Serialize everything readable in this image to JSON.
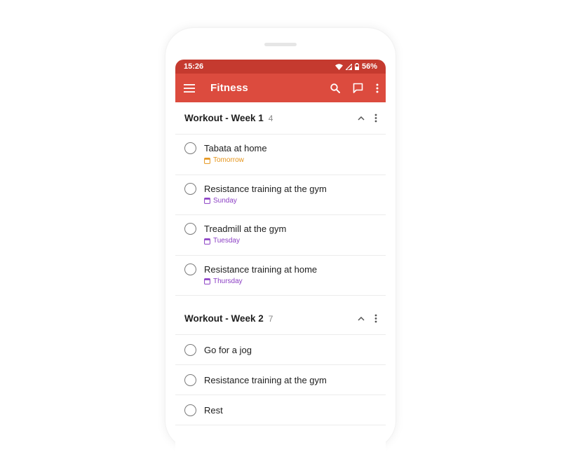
{
  "status_bar": {
    "time": "15:26",
    "battery": "56%"
  },
  "app_bar": {
    "title": "Fitness"
  },
  "colors": {
    "status_bar": "#c53a2f",
    "app_bar": "#dc4b3e",
    "date_orange": "#e5941a",
    "date_purple": "#8b3fc4"
  },
  "sections": [
    {
      "title": "Workout - Week 1",
      "count": "4",
      "tasks": [
        {
          "name": "Tabata at home",
          "date": "Tomorrow"
        },
        {
          "name": "Resistance training at the gym",
          "date": "Sunday"
        },
        {
          "name": "Treadmill at the gym",
          "date": "Tuesday"
        },
        {
          "name": "Resistance training at home",
          "date": "Thursday"
        }
      ]
    },
    {
      "title": "Workout - Week 2",
      "count": "7",
      "tasks": [
        {
          "name": "Go for a jog"
        },
        {
          "name": "Resistance training at the gym"
        },
        {
          "name": "Rest"
        }
      ]
    }
  ]
}
